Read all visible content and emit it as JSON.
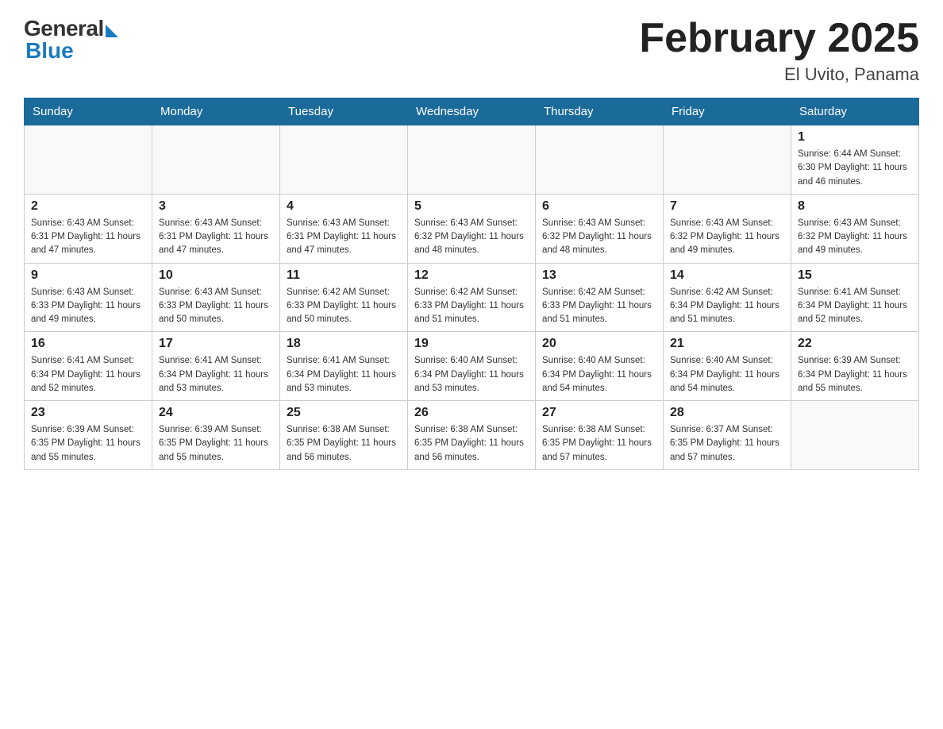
{
  "logo": {
    "general": "General",
    "blue": "Blue"
  },
  "title": "February 2025",
  "subtitle": "El Uvito, Panama",
  "days_of_week": [
    "Sunday",
    "Monday",
    "Tuesday",
    "Wednesday",
    "Thursday",
    "Friday",
    "Saturday"
  ],
  "weeks": [
    [
      {
        "day": "",
        "info": ""
      },
      {
        "day": "",
        "info": ""
      },
      {
        "day": "",
        "info": ""
      },
      {
        "day": "",
        "info": ""
      },
      {
        "day": "",
        "info": ""
      },
      {
        "day": "",
        "info": ""
      },
      {
        "day": "1",
        "info": "Sunrise: 6:44 AM\nSunset: 6:30 PM\nDaylight: 11 hours and 46 minutes."
      }
    ],
    [
      {
        "day": "2",
        "info": "Sunrise: 6:43 AM\nSunset: 6:31 PM\nDaylight: 11 hours and 47 minutes."
      },
      {
        "day": "3",
        "info": "Sunrise: 6:43 AM\nSunset: 6:31 PM\nDaylight: 11 hours and 47 minutes."
      },
      {
        "day": "4",
        "info": "Sunrise: 6:43 AM\nSunset: 6:31 PM\nDaylight: 11 hours and 47 minutes."
      },
      {
        "day": "5",
        "info": "Sunrise: 6:43 AM\nSunset: 6:32 PM\nDaylight: 11 hours and 48 minutes."
      },
      {
        "day": "6",
        "info": "Sunrise: 6:43 AM\nSunset: 6:32 PM\nDaylight: 11 hours and 48 minutes."
      },
      {
        "day": "7",
        "info": "Sunrise: 6:43 AM\nSunset: 6:32 PM\nDaylight: 11 hours and 49 minutes."
      },
      {
        "day": "8",
        "info": "Sunrise: 6:43 AM\nSunset: 6:32 PM\nDaylight: 11 hours and 49 minutes."
      }
    ],
    [
      {
        "day": "9",
        "info": "Sunrise: 6:43 AM\nSunset: 6:33 PM\nDaylight: 11 hours and 49 minutes."
      },
      {
        "day": "10",
        "info": "Sunrise: 6:43 AM\nSunset: 6:33 PM\nDaylight: 11 hours and 50 minutes."
      },
      {
        "day": "11",
        "info": "Sunrise: 6:42 AM\nSunset: 6:33 PM\nDaylight: 11 hours and 50 minutes."
      },
      {
        "day": "12",
        "info": "Sunrise: 6:42 AM\nSunset: 6:33 PM\nDaylight: 11 hours and 51 minutes."
      },
      {
        "day": "13",
        "info": "Sunrise: 6:42 AM\nSunset: 6:33 PM\nDaylight: 11 hours and 51 minutes."
      },
      {
        "day": "14",
        "info": "Sunrise: 6:42 AM\nSunset: 6:34 PM\nDaylight: 11 hours and 51 minutes."
      },
      {
        "day": "15",
        "info": "Sunrise: 6:41 AM\nSunset: 6:34 PM\nDaylight: 11 hours and 52 minutes."
      }
    ],
    [
      {
        "day": "16",
        "info": "Sunrise: 6:41 AM\nSunset: 6:34 PM\nDaylight: 11 hours and 52 minutes."
      },
      {
        "day": "17",
        "info": "Sunrise: 6:41 AM\nSunset: 6:34 PM\nDaylight: 11 hours and 53 minutes."
      },
      {
        "day": "18",
        "info": "Sunrise: 6:41 AM\nSunset: 6:34 PM\nDaylight: 11 hours and 53 minutes."
      },
      {
        "day": "19",
        "info": "Sunrise: 6:40 AM\nSunset: 6:34 PM\nDaylight: 11 hours and 53 minutes."
      },
      {
        "day": "20",
        "info": "Sunrise: 6:40 AM\nSunset: 6:34 PM\nDaylight: 11 hours and 54 minutes."
      },
      {
        "day": "21",
        "info": "Sunrise: 6:40 AM\nSunset: 6:34 PM\nDaylight: 11 hours and 54 minutes."
      },
      {
        "day": "22",
        "info": "Sunrise: 6:39 AM\nSunset: 6:34 PM\nDaylight: 11 hours and 55 minutes."
      }
    ],
    [
      {
        "day": "23",
        "info": "Sunrise: 6:39 AM\nSunset: 6:35 PM\nDaylight: 11 hours and 55 minutes."
      },
      {
        "day": "24",
        "info": "Sunrise: 6:39 AM\nSunset: 6:35 PM\nDaylight: 11 hours and 55 minutes."
      },
      {
        "day": "25",
        "info": "Sunrise: 6:38 AM\nSunset: 6:35 PM\nDaylight: 11 hours and 56 minutes."
      },
      {
        "day": "26",
        "info": "Sunrise: 6:38 AM\nSunset: 6:35 PM\nDaylight: 11 hours and 56 minutes."
      },
      {
        "day": "27",
        "info": "Sunrise: 6:38 AM\nSunset: 6:35 PM\nDaylight: 11 hours and 57 minutes."
      },
      {
        "day": "28",
        "info": "Sunrise: 6:37 AM\nSunset: 6:35 PM\nDaylight: 11 hours and 57 minutes."
      },
      {
        "day": "",
        "info": ""
      }
    ]
  ]
}
